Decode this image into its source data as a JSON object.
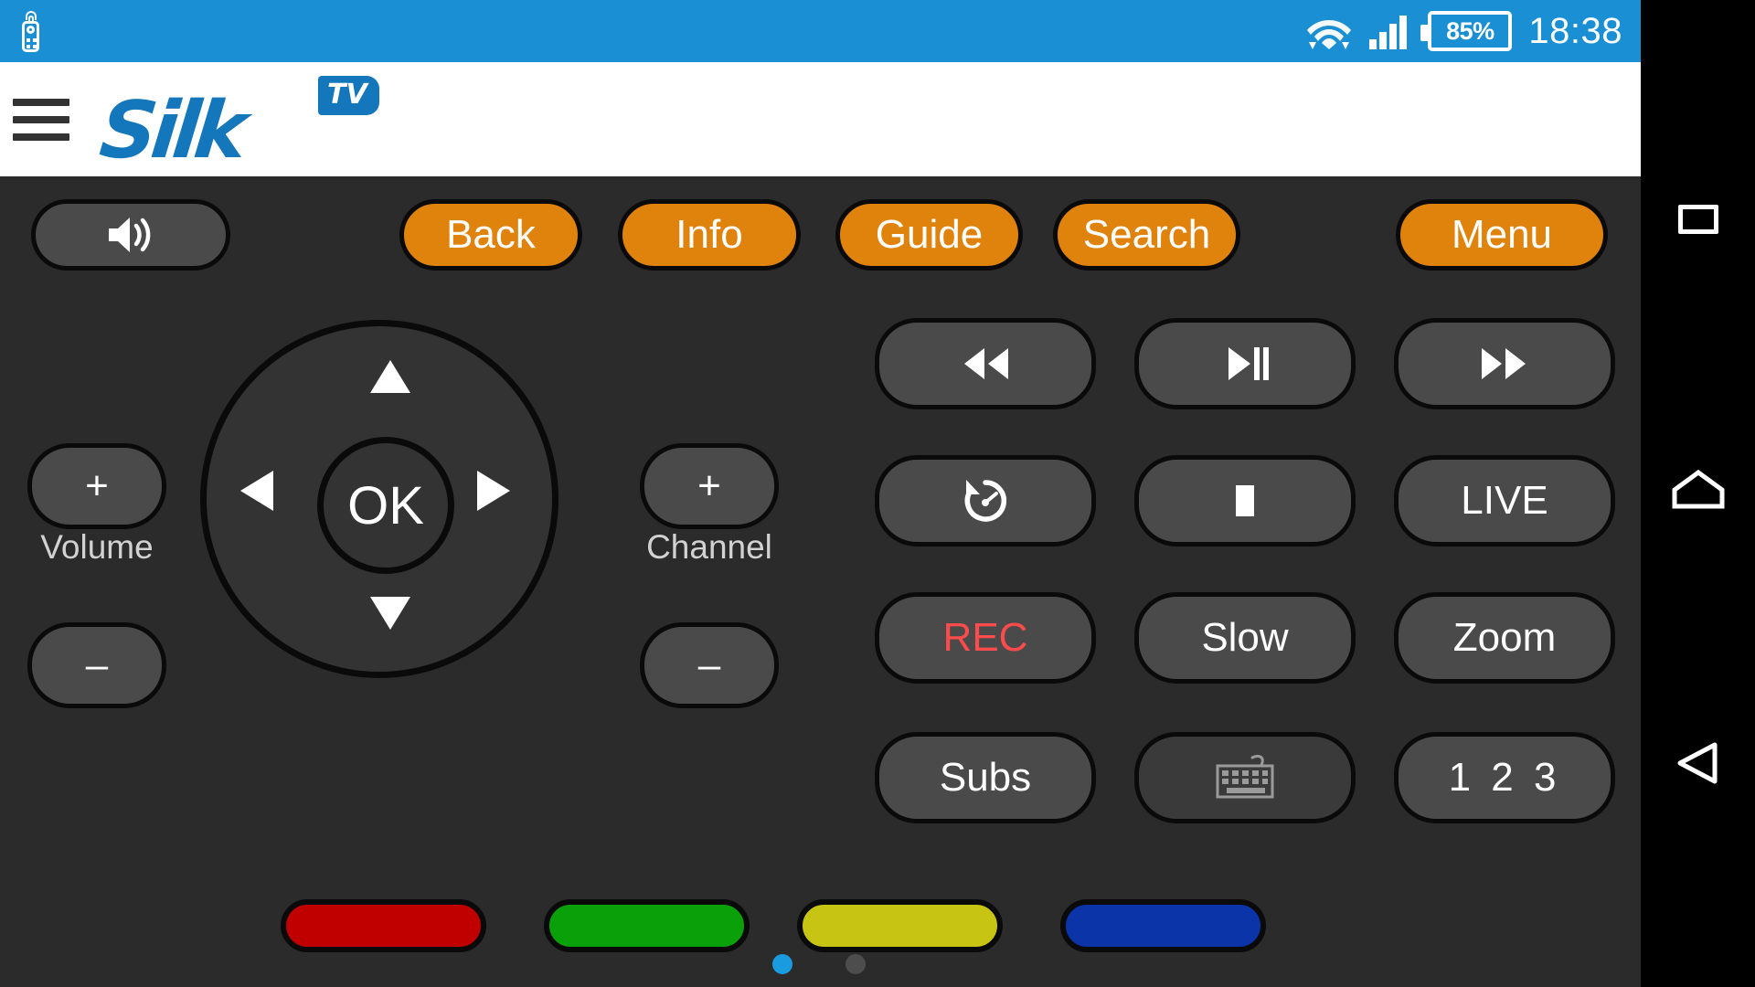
{
  "status_bar": {
    "notification_icon": "remote-control-icon",
    "wifi_icon": "wifi-icon",
    "cellular_icon": "cellular-signal-icon",
    "battery_label": "85%",
    "time": "18:38",
    "background_color": "#1a8fd4"
  },
  "app_bar": {
    "menu_icon": "hamburger-menu-icon",
    "logo_text": "Silk",
    "logo_badge": "TV",
    "brand_color": "#1476bb"
  },
  "remote": {
    "background_color": "#2b2b2b",
    "accent_orange": "#e0830d",
    "top_row": [
      {
        "name": "mute",
        "label": "",
        "icon": "speaker-volume-icon",
        "style": "grey"
      },
      {
        "name": "back",
        "label": "Back",
        "style": "orange"
      },
      {
        "name": "info",
        "label": "Info",
        "style": "orange"
      },
      {
        "name": "guide",
        "label": "Guide",
        "style": "orange"
      },
      {
        "name": "search",
        "label": "Search",
        "style": "orange"
      },
      {
        "name": "menu",
        "label": "Menu",
        "style": "orange"
      }
    ],
    "volume": {
      "label": "Volume",
      "plus": "+",
      "minus": "–"
    },
    "channel": {
      "label": "Channel",
      "plus": "+",
      "minus": "–"
    },
    "dpad": {
      "ok_label": "OK",
      "up_icon": "arrow-up-icon",
      "down_icon": "arrow-down-icon",
      "left_icon": "arrow-left-icon",
      "right_icon": "arrow-right-icon"
    },
    "media_grid": [
      {
        "name": "rewind",
        "label": "",
        "icon": "rewind-icon"
      },
      {
        "name": "play-pause",
        "label": "",
        "icon": "play-pause-icon"
      },
      {
        "name": "fast-forward",
        "label": "",
        "icon": "fast-forward-icon"
      },
      {
        "name": "restart",
        "label": "",
        "icon": "restart-icon"
      },
      {
        "name": "stop",
        "label": "",
        "icon": "stop-icon"
      },
      {
        "name": "live",
        "label": "LIVE",
        "icon": ""
      },
      {
        "name": "record",
        "label": "REC",
        "icon": "",
        "color": "#ff4b4b"
      },
      {
        "name": "slow",
        "label": "Slow",
        "icon": ""
      },
      {
        "name": "zoom",
        "label": "Zoom",
        "icon": ""
      },
      {
        "name": "subtitles",
        "label": "Subs",
        "icon": ""
      },
      {
        "name": "keyboard",
        "label": "",
        "icon": "keyboard-icon",
        "disabled": true
      },
      {
        "name": "numeric",
        "label": "1 2 3",
        "icon": ""
      }
    ],
    "color_buttons": [
      {
        "name": "red",
        "color": "#c00000"
      },
      {
        "name": "green",
        "color": "#0aa00a"
      },
      {
        "name": "yellow",
        "color": "#c8c413"
      },
      {
        "name": "blue",
        "color": "#0a34a8"
      }
    ],
    "page_indicators": [
      {
        "name": "page-1",
        "active": true,
        "color": "#1a9be0"
      },
      {
        "name": "page-2",
        "active": false,
        "color": "#4d4d4d"
      }
    ]
  },
  "nav_bar": {
    "recents_icon": "recents-square-icon",
    "home_icon": "home-icon",
    "back_icon": "back-triangle-icon"
  }
}
